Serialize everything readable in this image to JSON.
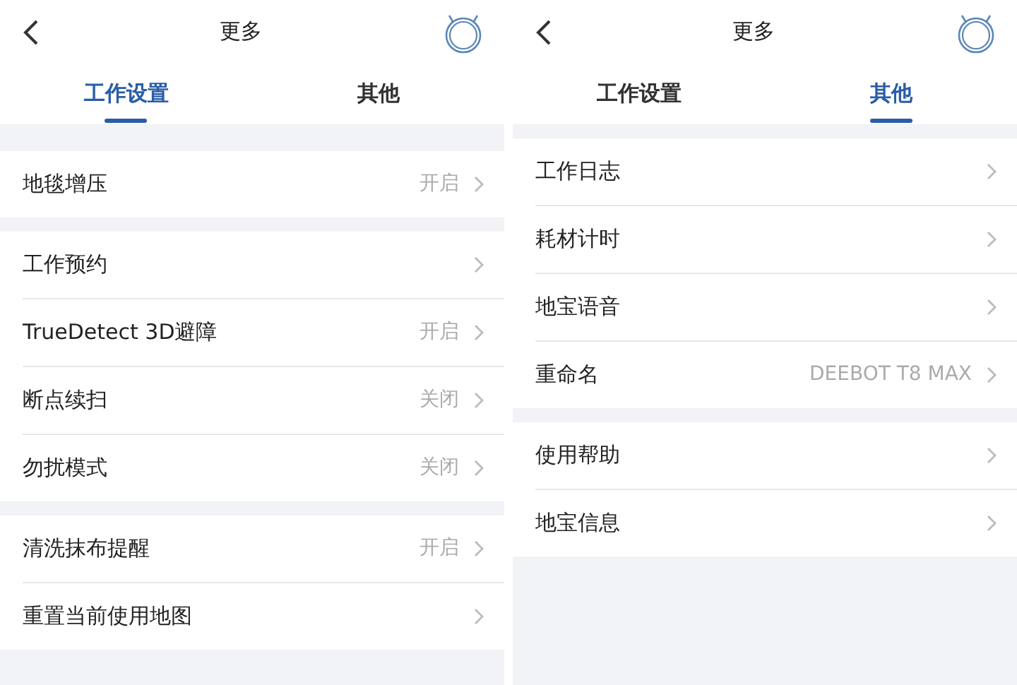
{
  "screens": [
    {
      "title": "更多",
      "tabs": [
        {
          "label": "工作设置",
          "selected": true
        },
        {
          "label": "其他",
          "selected": false
        }
      ],
      "groups": [
        [
          {
            "label": "地毯增压",
            "value": "开启"
          }
        ],
        [
          {
            "label": "工作预约"
          },
          {
            "label": "TrueDetect 3D避障",
            "value": "开启"
          },
          {
            "label": "断点续扫",
            "value": "关闭"
          },
          {
            "label": "勿扰模式",
            "value": "关闭"
          }
        ],
        [
          {
            "label": "清洗抹布提醒",
            "value": "开启"
          },
          {
            "label": "重置当前使用地图"
          }
        ]
      ]
    },
    {
      "title": "更多",
      "tabs": [
        {
          "label": "工作设置",
          "selected": false
        },
        {
          "label": "其他",
          "selected": true
        }
      ],
      "groups": [
        [
          {
            "label": "工作日志"
          },
          {
            "label": "耗材计时"
          },
          {
            "label": "地宝语音"
          },
          {
            "label": "重命名",
            "value": "DEEBOT T8 MAX"
          }
        ],
        [
          {
            "label": "使用帮助"
          },
          {
            "label": "地宝信息"
          }
        ]
      ]
    }
  ]
}
